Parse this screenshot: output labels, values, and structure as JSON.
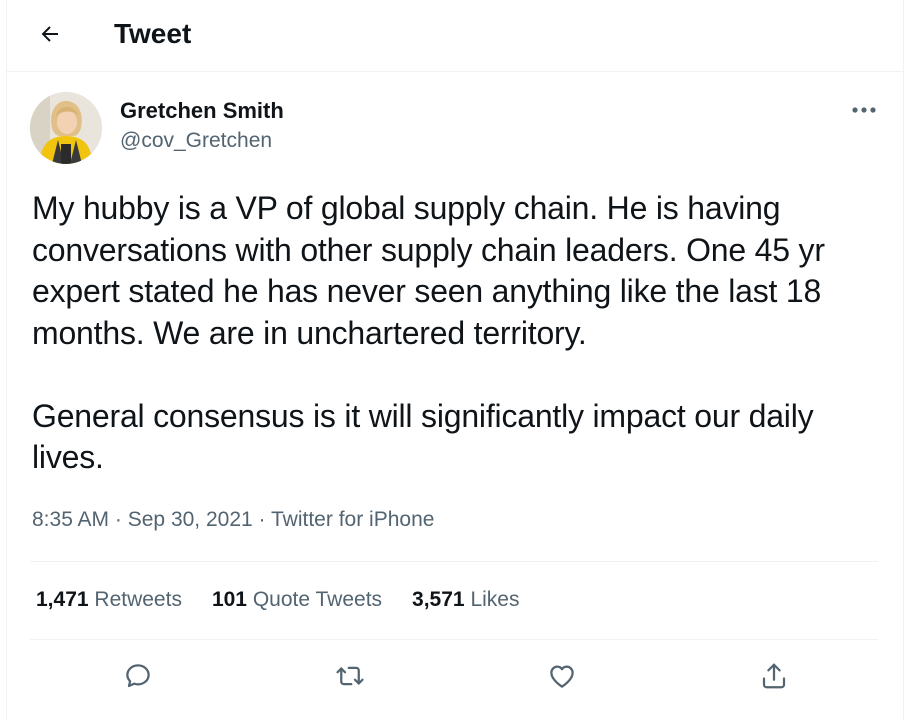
{
  "header": {
    "title": "Tweet",
    "back_icon": "arrow-left-icon"
  },
  "author": {
    "display_name": "Gretchen Smith",
    "handle": "@cov_Gretchen",
    "more_icon": "more-horizontal-icon"
  },
  "tweet": {
    "paragraphs": [
      "My hubby is a VP of global supply chain. He is having conversations with other supply chain leaders. One 45 yr expert stated he has never seen anything like the last 18 months. We are in unchartered territory.",
      "General consensus is it will significantly impact our daily lives."
    ],
    "time": "8:35 AM",
    "date": "Sep 30, 2021",
    "source": "Twitter for iPhone",
    "separator": "·"
  },
  "stats": {
    "retweets": {
      "count": "1,471",
      "label": "Retweets"
    },
    "quote_tweets": {
      "count": "101",
      "label": "Quote Tweets"
    },
    "likes": {
      "count": "3,571",
      "label": "Likes"
    }
  },
  "actions": {
    "reply_icon": "reply-icon",
    "retweet_icon": "retweet-icon",
    "like_icon": "heart-icon",
    "share_icon": "share-icon"
  },
  "colors": {
    "text": "#0f1419",
    "secondary": "#536471",
    "border": "#eff3f4"
  }
}
